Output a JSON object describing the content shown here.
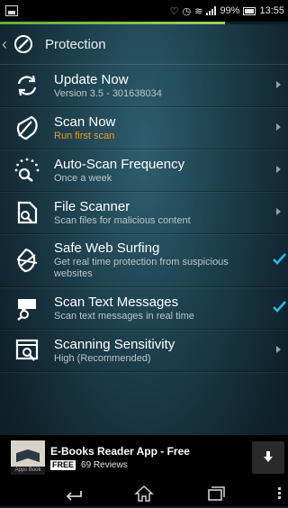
{
  "status_bar": {
    "battery": "99%",
    "time": "13:55"
  },
  "progress": {
    "fraction": 0.78
  },
  "action_bar": {
    "title": "Protection"
  },
  "items": [
    {
      "title": "Update Now",
      "subtitle": "Version 3.5 - 301638034",
      "control": "chevron"
    },
    {
      "title": "Scan Now",
      "subtitle": "Run first scan",
      "subtitle_color": "#f39a1e",
      "control": "chevron"
    },
    {
      "title": "Auto-Scan Frequency",
      "subtitle": "Once a week",
      "control": "chevron"
    },
    {
      "title": "File Scanner",
      "subtitle": "Scan files for malicious content",
      "control": "chevron"
    },
    {
      "title": "Safe Web Surfing",
      "subtitle": "Get real time protection from suspicious websites",
      "control": "checkbox",
      "checked": true
    },
    {
      "title": "Scan Text Messages",
      "subtitle": "Scan text messages in real time",
      "control": "checkbox",
      "checked": true
    },
    {
      "title": "Scanning Sensitivity",
      "subtitle": "High (Recommended)",
      "control": "chevron"
    }
  ],
  "ad": {
    "title": "E-Books Reader App - Free",
    "badge": "FREE",
    "reviews": "69 Reviews",
    "thumb_caption": "Apps Book"
  },
  "colors": {
    "accent_check": "#33b5e5",
    "warning": "#f39a1e",
    "progress": "#7cc04a"
  }
}
